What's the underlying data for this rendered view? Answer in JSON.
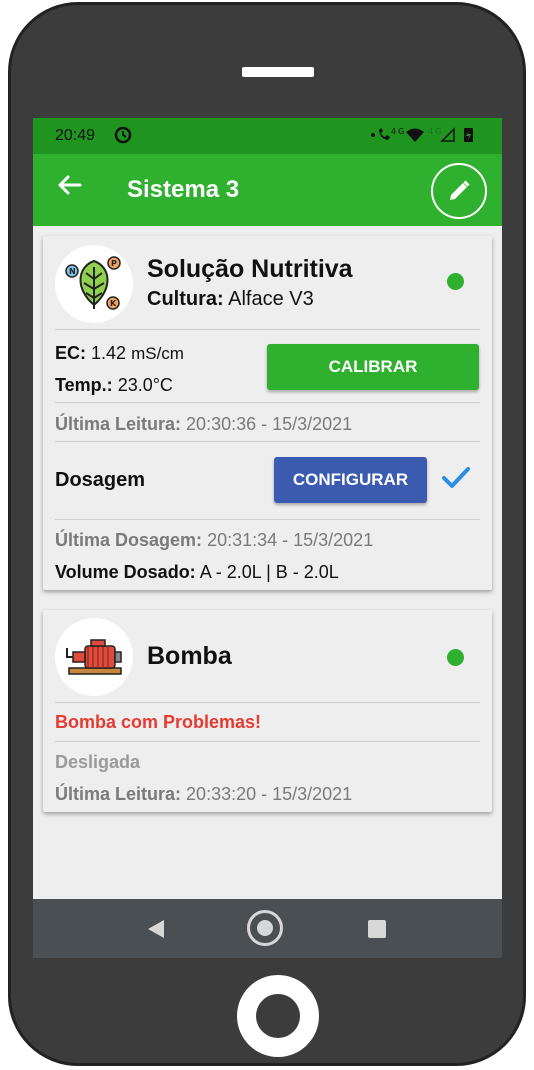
{
  "statusbar": {
    "time": "20:49",
    "sync_icon": "sync-icon",
    "icons_text": "•📞⁴ᴳ",
    "dim_text": "⁴ᴳ"
  },
  "appbar": {
    "title": "Sistema 3",
    "back_icon": "arrow-left-icon",
    "edit_icon": "pencil-icon"
  },
  "nutrient_card": {
    "title": "Solução Nutritiva",
    "culture_label": "Cultura:",
    "culture_value": "Alface V3",
    "status_color": "#2fb02f",
    "ec_label": "EC:",
    "ec_value": "1.42",
    "ec_unit": "mS/cm",
    "temp_label": "Temp.:",
    "temp_value": "23.0°C",
    "calibrate_button": "CALIBRAR",
    "last_reading_label": "Última Leitura:",
    "last_reading_value": "20:30:36 - 15/3/2021",
    "dosing_label": "Dosagem",
    "configure_button": "CONFIGURAR",
    "last_dosing_label": "Última Dosagem:",
    "last_dosing_value": "20:31:34 - 15/3/2021",
    "volume_label": "Volume Dosado:",
    "volume_value": "A - 2.0L | B - 2.0L",
    "npk": [
      "N",
      "P",
      "K"
    ]
  },
  "pump_card": {
    "title": "Bomba",
    "status_color": "#2fb02f",
    "problem_text": "Bomba com Problemas!",
    "state_text": "Desligada",
    "last_reading_label": "Última Leitura:",
    "last_reading_value": "20:33:20 - 15/3/2021"
  },
  "colors": {
    "primary": "#2fb02f",
    "statusbar": "#1f951f",
    "configure": "#3b5bb0",
    "error": "#e53b32",
    "check": "#2d8de0"
  }
}
